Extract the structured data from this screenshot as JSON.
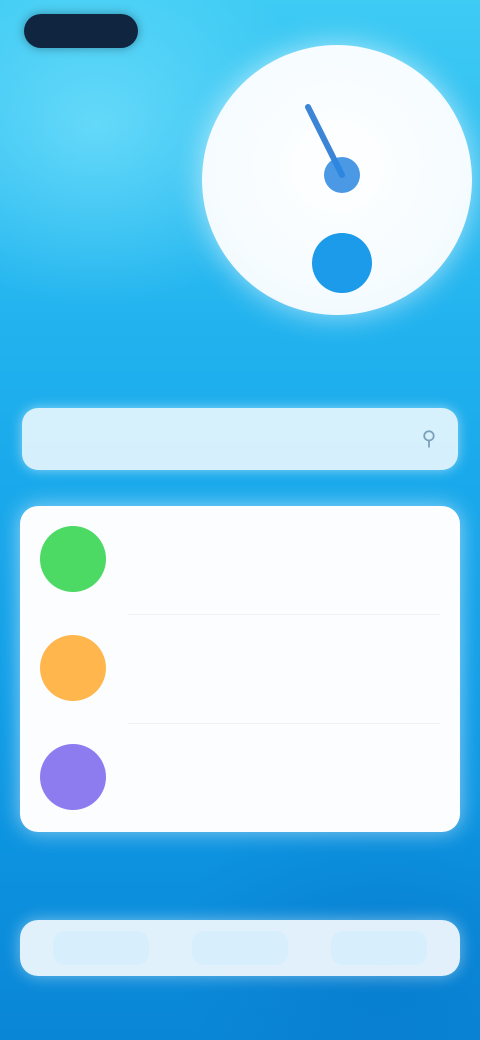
{
  "header": {
    "status_pill": ""
  },
  "hero": {
    "icon": "timer-icon"
  },
  "section": {
    "title": ""
  },
  "search": {
    "placeholder": "",
    "value": ""
  },
  "list": {
    "items": [
      {
        "title": "",
        "subtitle": "",
        "meta": "",
        "color": "#4cd964"
      },
      {
        "title": "",
        "subtitle": "",
        "meta": "",
        "color": "#ffb74d"
      },
      {
        "title": "",
        "subtitle": "",
        "meta": "",
        "color": "#8c7cf0"
      }
    ]
  },
  "bottom_nav": {
    "items": [
      {
        "label": ""
      },
      {
        "label": ""
      },
      {
        "label": ""
      }
    ]
  },
  "colors": {
    "background_top": "#3ecbf4",
    "background_bottom": "#0a86d6",
    "accent": "#1aa6ee",
    "card": "#fbfdff"
  }
}
